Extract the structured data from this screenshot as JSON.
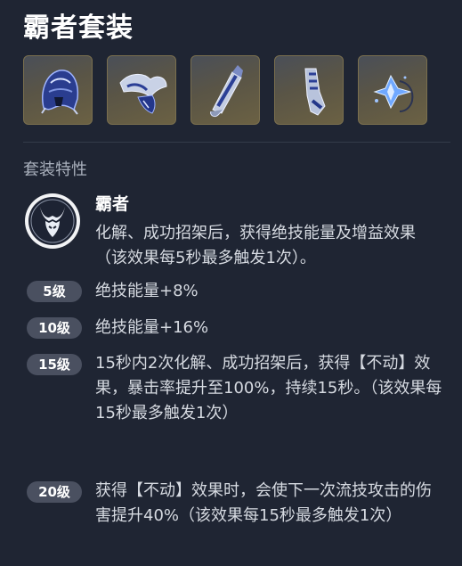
{
  "set": {
    "title": "霸者套装",
    "gear_slots": [
      {
        "icon": "helmet-icon"
      },
      {
        "icon": "shoulder-armor-icon"
      },
      {
        "icon": "bracer-icon"
      },
      {
        "icon": "greaves-icon"
      },
      {
        "icon": "crystal-amulet-icon"
      }
    ]
  },
  "traits": {
    "section_title": "套装特性",
    "emblem_icon": "horned-mask-icon",
    "name": "霸者",
    "description": "化解、成功招架后，获得绝技能量及增益效果（该效果每5秒最多触发1次）。"
  },
  "tiers": [
    {
      "badge": "5级",
      "text": "绝技能量+8%"
    },
    {
      "badge": "10级",
      "text": "绝技能量+16%"
    },
    {
      "badge": "15级",
      "text": "15秒内2次化解、成功招架后，获得【不动】效果，暴击率提升至100%，持续15秒。（该效果每15秒最多触发1次）"
    },
    {
      "badge": "20级",
      "text": "获得【不动】效果时，会使下一次流技攻击的伤害提升40%（该效果每15秒最多触发1次）"
    }
  ],
  "colors": {
    "background": "#1f2533",
    "badge": "#4a5060",
    "gear_slot_gold": "#6b6143"
  }
}
